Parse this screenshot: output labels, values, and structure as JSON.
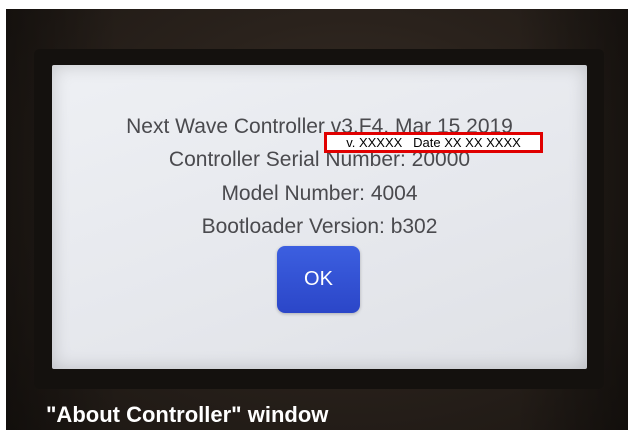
{
  "dialog": {
    "line1": "Next Wave Controller v3.F4, Mar 15 2019",
    "line2": "Controller Serial Number: 20000",
    "line3": "Model Number: 4004",
    "line4": "Bootloader Version: b302",
    "ok_label": "OK"
  },
  "redaction": {
    "text": "v. XXXXX   Date XX XX XXXX"
  },
  "caption": "\"About Controller\" window",
  "colors": {
    "button": "#2f4fd4",
    "redaction_border": "#e00000",
    "screen_text": "#4a4a4e"
  }
}
